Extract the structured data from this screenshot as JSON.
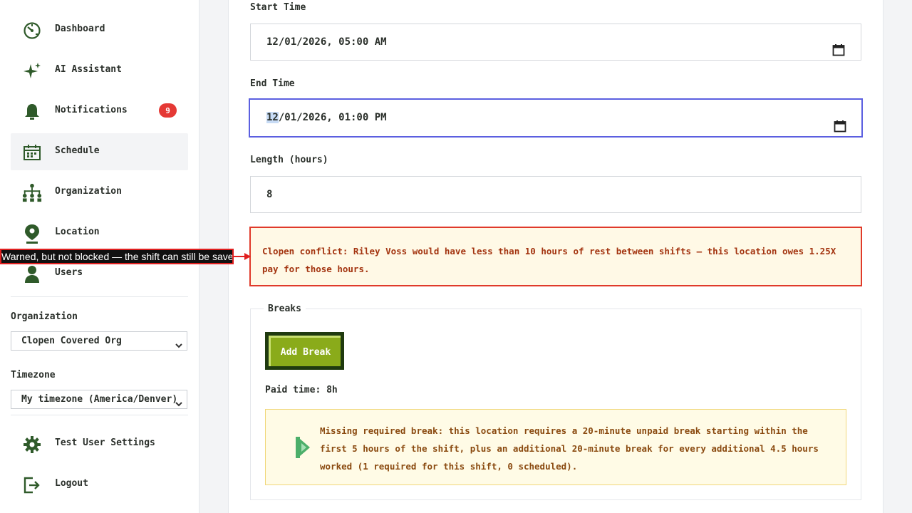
{
  "sidebar": {
    "items": [
      {
        "label": "Dashboard",
        "icon": "dashboard-icon"
      },
      {
        "label": "AI Assistant",
        "icon": "sparkle-icon"
      },
      {
        "label": "Notifications",
        "icon": "bell-icon",
        "badge": "9"
      },
      {
        "label": "Schedule",
        "icon": "calendar-icon",
        "active": true
      },
      {
        "label": "Organization",
        "icon": "org-chart-icon"
      },
      {
        "label": "Location",
        "icon": "location-pin-icon"
      },
      {
        "label": "Users",
        "icon": "user-icon"
      }
    ],
    "organization_label": "Organization",
    "organization_value": "Clopen Covered Org",
    "timezone_label": "Timezone",
    "timezone_value": "My timezone (America/Denver)",
    "settings_label": "Test User Settings",
    "logout_label": "Logout"
  },
  "form": {
    "start_label": "Start Time",
    "start_value": "12/01/2026, 05:00 AM",
    "end_label": "End Time",
    "end_value_selected": "12",
    "end_value_rest": "/01/2026, 01:00 PM",
    "length_label": "Length (hours)",
    "length_value": "8",
    "clopen_error": "Clopen conflict: Riley Voss would have less than 10 hours of rest between shifts — this location owes 1.25X pay for those hours.",
    "breaks_legend": "Breaks",
    "add_break_label": "Add Break",
    "paid_time": "Paid time: 8h",
    "break_warning": "Missing required break: this location requires a 20-minute unpaid break starting within the first 5 hours of the shift, plus an additional 20-minute break for every additional 4.5 hours worked (1 required for this shift, 0 scheduled)."
  },
  "annotation": {
    "callout_text": "Warned, but not blocked — the shift can still be saved"
  },
  "colors": {
    "icon_green": "#2f5a2a",
    "accent_focus": "#5b5fe0",
    "error_red": "#e03a2a",
    "badge_red": "#e53935",
    "button_green": "#8aab1a"
  }
}
